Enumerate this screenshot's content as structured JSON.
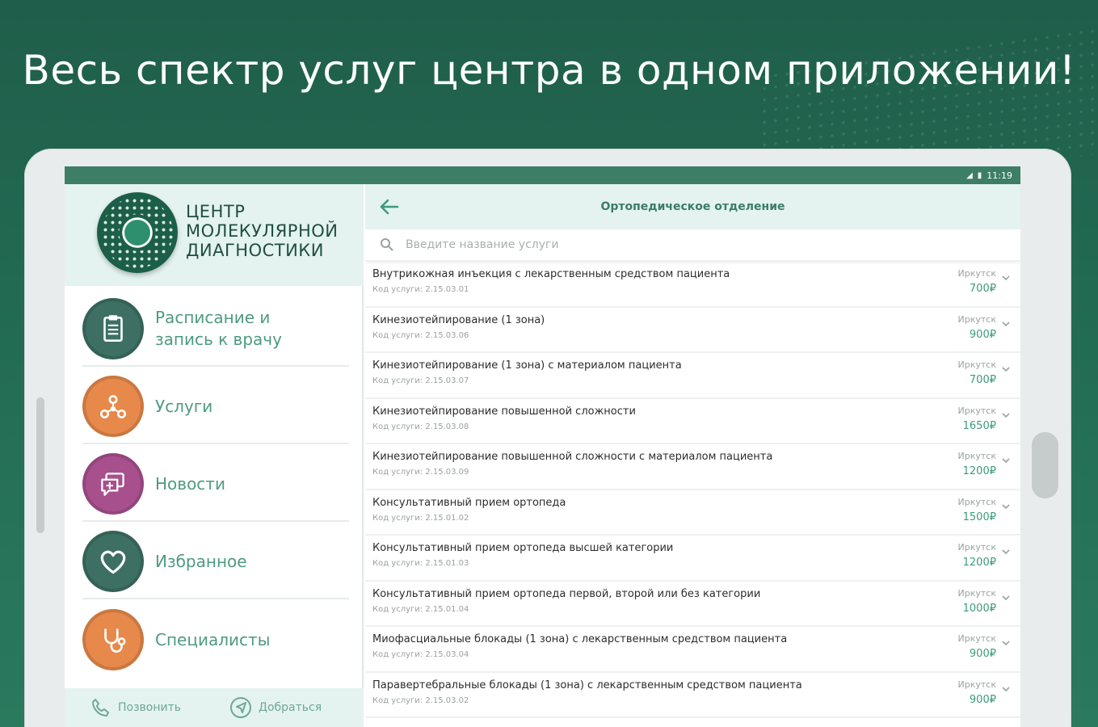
{
  "headline": "Весь спектр услуг центра в одном приложении!",
  "status": {
    "time": "11:19"
  },
  "logo": {
    "line1": "ЦЕНТР",
    "line2": "МОЛЕКУЛЯРНОЙ",
    "line3": "ДИАГНОСТИКИ"
  },
  "menu": [
    {
      "label_line1": "Расписание и",
      "label_line2": "запись к врачу",
      "icon": "clipboard-icon",
      "color": "#3d6f63"
    },
    {
      "label_line1": "Услуги",
      "label_line2": "",
      "icon": "services-network-icon",
      "color": "#e6894a"
    },
    {
      "label_line1": "Новости",
      "label_line2": "",
      "icon": "news-chat-icon",
      "color": "#a8508e"
    },
    {
      "label_line1": "Избранное",
      "label_line2": "",
      "icon": "heart-icon",
      "color": "#3d6f63"
    },
    {
      "label_line1": "Специалисты",
      "label_line2": "",
      "icon": "stethoscope-icon",
      "color": "#e6894a"
    }
  ],
  "footer": {
    "call_label": "Позвонить",
    "route_label": "Добраться"
  },
  "pane": {
    "title": "Ортопедическое отделение",
    "search_placeholder": "Введите название услуги"
  },
  "services": [
    {
      "name": "Внутрикожная инъекция с лекарственным средством пациента",
      "code": "Код услуги: 2.15.03.01",
      "city": "Иркутск",
      "price": "700₽"
    },
    {
      "name": "Кинезиотейпирование (1 зона)",
      "code": "Код услуги: 2.15.03.06",
      "city": "Иркутск",
      "price": "900₽"
    },
    {
      "name": "Кинезиотейпирование (1 зона) с материалом пациента",
      "code": "Код услуги: 2.15.03.07",
      "city": "Иркутск",
      "price": "700₽"
    },
    {
      "name": "Кинезиотейпирование повышенной сложности",
      "code": "Код услуги: 2.15.03.08",
      "city": "Иркутск",
      "price": "1650₽"
    },
    {
      "name": "Кинезиотейпирование повышенной сложности с материалом пациента",
      "code": "Код услуги: 2.15.03.09",
      "city": "Иркутск",
      "price": "1200₽"
    },
    {
      "name": "Консультативный прием ортопеда",
      "code": "Код услуги: 2.15.01.02",
      "city": "Иркутск",
      "price": "1500₽"
    },
    {
      "name": "Консультативный прием ортопеда высшей категории",
      "code": "Код услуги: 2.15.01.03",
      "city": "Иркутск",
      "price": "1200₽"
    },
    {
      "name": "Консультативный прием ортопеда первой, второй или без категории",
      "code": "Код услуги: 2.15.01.04",
      "city": "Иркутск",
      "price": "1000₽"
    },
    {
      "name": "Миофасциальные блокады (1 зона) с лекарственным средством пациента",
      "code": "Код услуги: 2.15.03.04",
      "city": "Иркутск",
      "price": "900₽"
    },
    {
      "name": "Паравертебральные блокады (1 зона) с лекарственным средством пациента",
      "code": "Код услуги: 2.15.03.02",
      "city": "Иркутск",
      "price": "900₽"
    }
  ]
}
